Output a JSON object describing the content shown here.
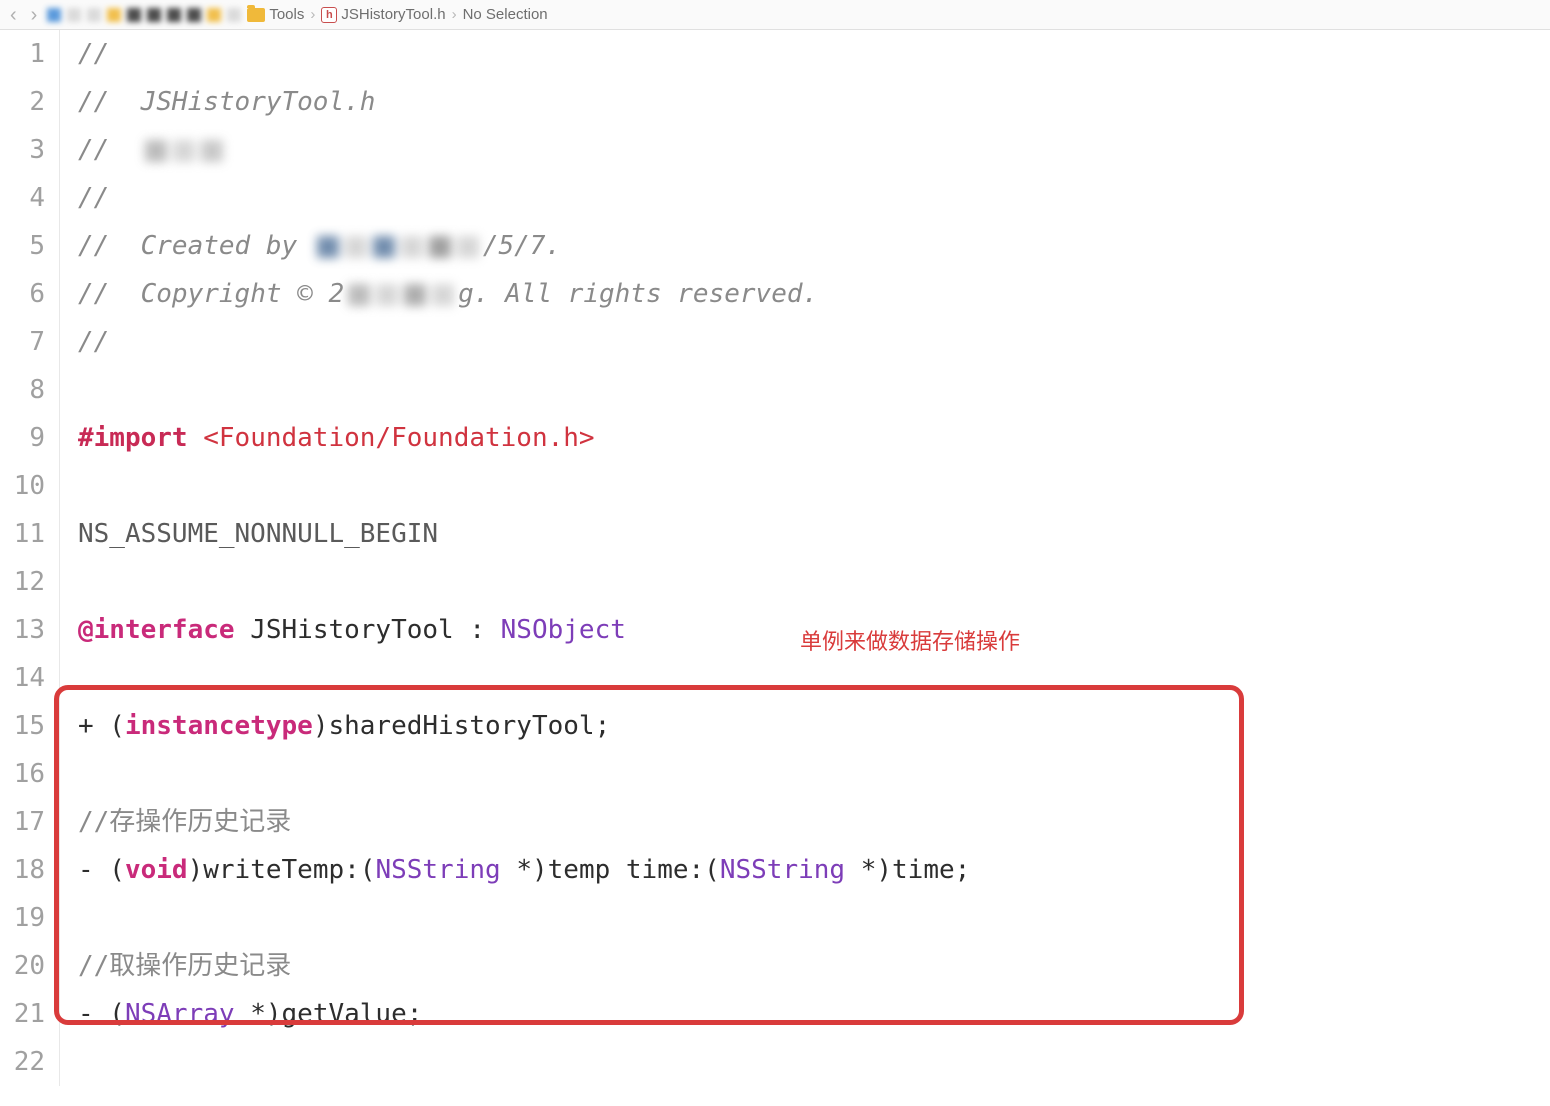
{
  "breadcrumb": {
    "items": [
      {
        "label": "Tools",
        "icon": "folder"
      },
      {
        "label": "JSHistoryTool.h",
        "icon": "h"
      },
      {
        "label": "No Selection",
        "icon": ""
      }
    ]
  },
  "gutter": {
    "start": 1,
    "end": 22,
    "lines": [
      "1",
      "2",
      "3",
      "4",
      "5",
      "6",
      "7",
      "8",
      "9",
      "10",
      "11",
      "12",
      "13",
      "14",
      "15",
      "16",
      "17",
      "18",
      "19",
      "20",
      "21",
      "22"
    ]
  },
  "code": {
    "l1": "//",
    "l2_a": "//  ",
    "l2_b": "JSHistoryTool.h",
    "l3": "//  ",
    "l4": "//",
    "l5_a": "//  ",
    "l5_b": "Created by ",
    "l5_c": "/5/7.",
    "l6_a": "//  ",
    "l6_b": "Copyright © 2",
    "l6_c": "g. All rights reserved.",
    "l7": "//",
    "l9_a": "#import",
    "l9_b": " ",
    "l9_c": "<Foundation/Foundation.h>",
    "l11": "NS_ASSUME_NONNULL_BEGIN",
    "l13_a": "@interface",
    "l13_b": " JSHistoryTool : ",
    "l13_c": "NSObject",
    "l15_a": "+ (",
    "l15_b": "instancetype",
    "l15_c": ")sharedHistoryTool;",
    "l17": "//存操作历史记录",
    "l18_a": "- (",
    "l18_b": "void",
    "l18_c": ")writeTemp:(",
    "l18_d": "NSString",
    "l18_e": " *)temp time:(",
    "l18_f": "NSString",
    "l18_g": " *)time;",
    "l20": "//取操作历史记录",
    "l21_a": "- (",
    "l21_b": "NSArray",
    "l21_c": " *)getValue;"
  },
  "annotation": {
    "label": "单例来做数据存储操作"
  }
}
